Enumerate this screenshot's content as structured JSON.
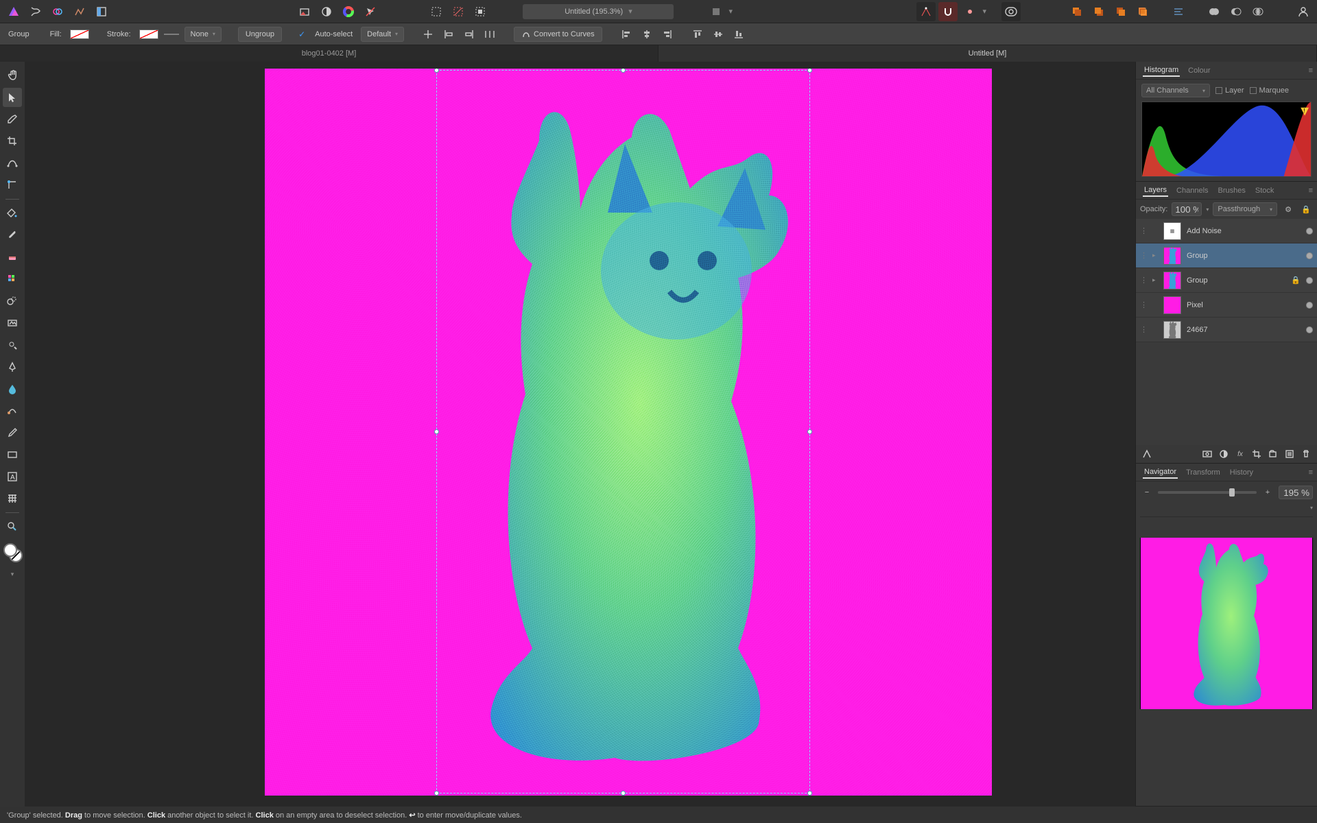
{
  "app": {
    "doc_title_pill": "Untitled (195.3%)"
  },
  "tabs": {
    "list": [
      {
        "label": "blog01-0402 [M]"
      },
      {
        "label": "Untitled [M]"
      }
    ],
    "active": 1
  },
  "context_toolbar": {
    "group_label": "Group",
    "fill_label": "Fill:",
    "stroke_label": "Stroke:",
    "none_label": "None",
    "ungroup_label": "Ungroup",
    "autoselect_label": "Auto-select",
    "convert_label": "Convert to Curves",
    "policy_select": "Default"
  },
  "tools": [
    "hand-tool",
    "move-tool",
    "color-picker-tool",
    "crop-tool",
    "node-secondary-tool",
    "corner-tool",
    "SEP",
    "flood-fill-tool",
    "paintbrush-tool",
    "erase-tool",
    "pixel-tool",
    "clone-tool",
    "inpainting-tool",
    "dodge-tool",
    "pen-tool",
    "blur-tool",
    "smudge-tool",
    "retouch-tool",
    "rectangle-tool",
    "text-tool",
    "mesh-tool",
    "SEP",
    "zoom-tool"
  ],
  "active_tool_index": 1,
  "panels": {
    "histogram": {
      "tabs": [
        "Histogram",
        "Colour"
      ],
      "active": 0,
      "channel_select": "All Channels",
      "layer_check": "Layer",
      "marquee_check": "Marquee"
    },
    "layers": {
      "tabs": [
        "Layers",
        "Channels",
        "Brushes",
        "Stock"
      ],
      "active": 0,
      "opacity_label": "Opacity:",
      "opacity_value": "100 %",
      "blend_mode": "Passthrough",
      "items": [
        {
          "name": "Add Noise",
          "thumb": "fx",
          "selected": false,
          "arrow": false
        },
        {
          "name": "Group",
          "thumb": "cat",
          "selected": true,
          "arrow": true
        },
        {
          "name": "Group",
          "thumb": "cat",
          "selected": false,
          "arrow": true,
          "locked": true
        },
        {
          "name": "Pixel",
          "thumb": "pink",
          "selected": false,
          "arrow": false
        },
        {
          "name": "24667",
          "thumb": "cat-gray",
          "selected": false,
          "arrow": false
        }
      ]
    },
    "navigator": {
      "tabs": [
        "Navigator",
        "Transform",
        "History"
      ],
      "active": 0,
      "zoom_value": "195 %",
      "zoom_pos_pct": 72
    }
  },
  "status": {
    "text_parts": [
      "'Group' selected. ",
      "Drag",
      " to move selection. ",
      "Click",
      " another object to select it. ",
      "Click",
      " on an empty area to deselect selection. ",
      "↩",
      " to enter move/duplicate values."
    ]
  },
  "colors": {
    "canvas_bg": "#ff1ce5",
    "cat_fill1": "#3aa0d8",
    "cat_fill2": "#9ef07c"
  }
}
